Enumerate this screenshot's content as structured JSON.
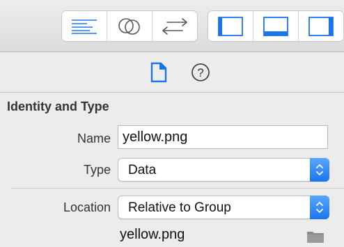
{
  "toolbar": {
    "editor_buttons": [
      {
        "icon": "standard-editor-icon"
      },
      {
        "icon": "assistant-editor-icon"
      },
      {
        "icon": "version-editor-icon"
      }
    ],
    "view_buttons": [
      {
        "icon": "navigator-toggle-icon"
      },
      {
        "icon": "debug-area-toggle-icon"
      },
      {
        "icon": "utilities-toggle-icon"
      }
    ],
    "accent_color": "#1a74f0"
  },
  "inspector_tabs": [
    {
      "icon": "file-inspector-icon",
      "selected": true
    },
    {
      "icon": "quick-help-icon",
      "selected": false
    }
  ],
  "identity": {
    "section_title": "Identity and Type",
    "name_label": "Name",
    "name_value": "yellow.png",
    "type_label": "Type",
    "type_value": "Data",
    "location_label": "Location",
    "location_value": "Relative to Group",
    "file_name": "yellow.png"
  }
}
